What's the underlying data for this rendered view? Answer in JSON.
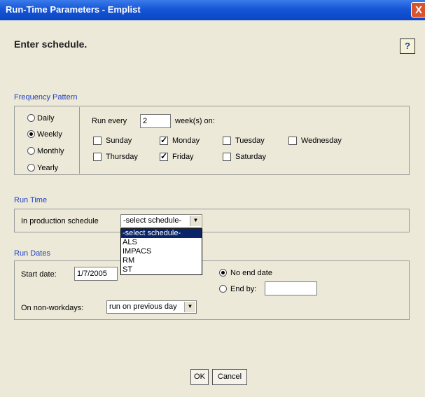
{
  "window": {
    "title": "Run-Time Parameters - Emplist",
    "close_glyph": "X"
  },
  "heading": "Enter schedule.",
  "help": {
    "glyph": "?"
  },
  "frequency": {
    "label": "Frequency Pattern",
    "options": [
      "Daily",
      "Weekly",
      "Monthly",
      "Yearly"
    ],
    "selected": "Weekly",
    "run_every_label": "Run every",
    "run_every_value": "2",
    "weeks_on_label": "week(s) on:",
    "days": [
      {
        "label": "Sunday",
        "checked": false
      },
      {
        "label": "Monday",
        "checked": true
      },
      {
        "label": "Tuesday",
        "checked": false
      },
      {
        "label": "Wednesday",
        "checked": false
      },
      {
        "label": "Thursday",
        "checked": false
      },
      {
        "label": "Friday",
        "checked": true
      },
      {
        "label": "Saturday",
        "checked": false
      }
    ]
  },
  "run_time": {
    "label": "Run Time",
    "schedule_label": "In production schedule",
    "schedule_value": "-select schedule-",
    "schedule_options": [
      "-select schedule-",
      "ALS",
      "IMPACS",
      "RM",
      "ST"
    ]
  },
  "run_dates": {
    "label": "Run Dates",
    "start_label": "Start date:",
    "start_value": "1/7/2005",
    "no_end_label": "No end date",
    "end_by_label": "End by:",
    "end_by_value": "",
    "end_selected": "No end date",
    "nonworkday_label": "On non-workdays:",
    "nonworkday_value": "run on previous day"
  },
  "buttons": {
    "ok": "OK",
    "cancel": "Cancel"
  },
  "colors": {
    "title_bar": "#1656d6",
    "dialog_bg": "#ece9d8",
    "section_label": "#2040c0",
    "selection": "#0a246a"
  },
  "icons": {
    "close": "close-icon",
    "help": "help-icon",
    "dropdown": "chevron-down-icon"
  }
}
